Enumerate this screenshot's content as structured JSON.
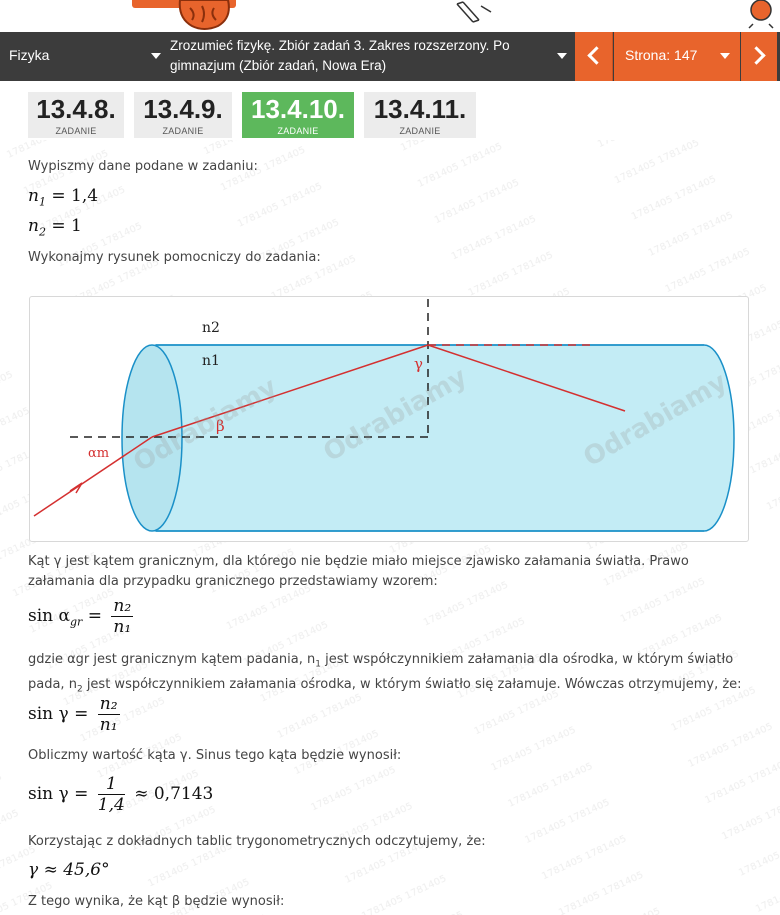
{
  "nav": {
    "subject": "Fizyka",
    "book": "Zrozumieć fizykę. Zbiór zadań 3. Zakres rozszerzony. Po gimnazjum (Zbiór zadań, Nowa Era)",
    "page": "Strona: 147"
  },
  "tiles": [
    {
      "number": "13.4.8.",
      "sub": "ZADANIE",
      "active": false
    },
    {
      "number": "13.4.9.",
      "sub": "ZADANIE",
      "active": false
    },
    {
      "number": "13.4.10.",
      "sub": "ZADANIE",
      "active": true
    },
    {
      "number": "13.4.11.",
      "sub": "ZADANIE",
      "active": false
    }
  ],
  "content": {
    "p1": "Wypiszmy dane podane w zadaniu:",
    "n1_lhs": "n",
    "n1_sub": "1",
    "n1_rhs": "= 1,4",
    "n2_lhs": "n",
    "n2_sub": "2",
    "n2_rhs": "= 1",
    "p2": "Wykonajmy rysunek pomocniczy do zadania:",
    "p3": "Kąt γ jest kątem granicznym, dla którego nie będzie miało miejsce zjawisko załamania światła. Prawo załamania dla przypadku granicznego przedstawiamy wzorem:",
    "eq1_lhs": "sin α",
    "eq1_sub": "gr",
    "eq1_num": "n₂",
    "eq1_den": "n₁",
    "p4a": "gdzie αgr jest granicznym kątem padania, n",
    "p4b": "1",
    "p4c": " jest współczynnikiem załamania dla ośrodka, w którym światło pada, n",
    "p4d": "2",
    "p4e": " jest współczynnikiem załamania ośrodka, w którym światło się załamuje. Wówczas otrzymujemy, że:",
    "eq2_lhs": "sin γ",
    "eq2_num": "n₂",
    "eq2_den": "n₁",
    "p5": "Obliczmy wartość kąta γ. Sinus tego kąta będzie wynosił:",
    "eq3_lhs": "sin γ",
    "eq3_num": "1",
    "eq3_den": "1,4",
    "eq3_rhs": "≈ 0,7143",
    "p6": "Korzystając z dokładnych tablic trygonometrycznych odczytujemy, że:",
    "eq4": "γ ≈ 45,6°",
    "p7": "Z tego wynika, że kąt β będzie wynosił:"
  },
  "figure": {
    "label_n2": "n2",
    "label_n1": "n1",
    "label_gamma": "γ",
    "label_beta": "β",
    "label_alpha": "αm",
    "watermark_brand": "Odrabiamy",
    "watermark_suffix": ".pl"
  },
  "colors": {
    "orange": "#e8642c",
    "green": "#5db85c",
    "navbar": "#3c3c3c",
    "cylinder": "#c3ecf5",
    "ray": "#d43030"
  }
}
